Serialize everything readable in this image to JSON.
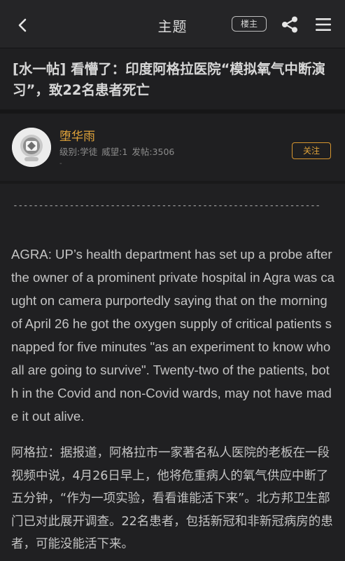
{
  "header": {
    "title": "主题",
    "op_label": "楼主",
    "back_icon": "chevron-left-icon",
    "share_icon": "share-icon",
    "menu_icon": "hamburger-menu-icon"
  },
  "post": {
    "title": "[水一帖] 看懵了：印度阿格拉医院“模拟氧气中断演习”，致22名患者死亡"
  },
  "author": {
    "name": "堕华雨",
    "meta": "级别:学徒 威望:1 发帖:3506",
    "sub": "-",
    "follow_label": "关注",
    "name_color": "#e0a33a"
  },
  "content": {
    "separator": "-------------------------------------------------------------------------",
    "english": "AGRA: UP’s health department has set up a probe after the owner of a prominent private hospital in Agra was caught on camera purportedly saying that on the morning of April 26 he got the oxygen supply of critical patients snapped for five minutes \"as an experiment to know who all are going to survive\". Twenty-two of the patients, both in the Covid and non-Covid wards, may not have made it out alive.",
    "chinese": "阿格拉：据报道，阿格拉市一家著名私人医院的老板在一段视频中说，4月26日早上，他将危重病人的氧气供应中断了五分钟，“作为一项实验，看看谁能活下来”。北方邦卫生部门已对此展开调查。22名患者，包括新冠和非新冠病房的患者，可能没能活下来。"
  }
}
